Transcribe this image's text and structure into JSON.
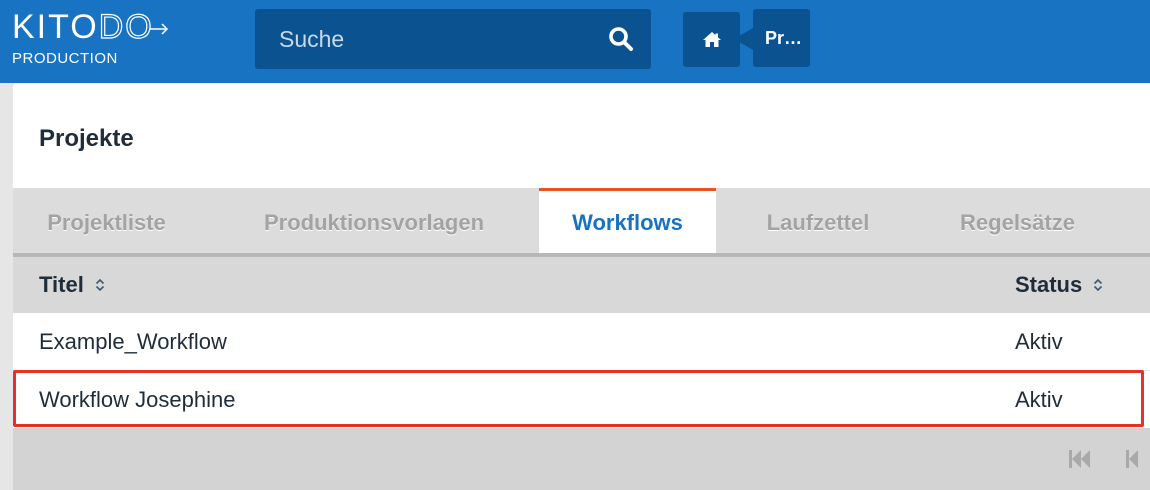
{
  "app": {
    "logo_main_a": "KITO",
    "logo_main_b": "DO",
    "logo_sub": "PRODUCTION"
  },
  "search": {
    "placeholder": "Suche",
    "icon": "search-icon"
  },
  "breadcrumb": {
    "home_icon": "home-icon",
    "current_label": "Pr…"
  },
  "page": {
    "title": "Projekte"
  },
  "tabs": [
    {
      "label": "Projektliste",
      "active": false
    },
    {
      "label": "Produktionsvorlagen",
      "active": false
    },
    {
      "label": "Workflows",
      "active": true
    },
    {
      "label": "Laufzettel",
      "active": false
    },
    {
      "label": "Regelsätze",
      "active": false
    }
  ],
  "table": {
    "columns": [
      {
        "label": "Titel",
        "sortable": true
      },
      {
        "label": "Status",
        "sortable": true
      }
    ],
    "rows": [
      {
        "title": "Example_Workflow",
        "status": "Aktiv"
      },
      {
        "title": "Workflow Josephine",
        "status": "Aktiv",
        "highlighted": true
      }
    ],
    "pager": {
      "icons": [
        "first-page-icon",
        "previous-page-icon"
      ]
    }
  },
  "colors": {
    "header_blue": "#1873c2",
    "header_dark_blue": "#0b5290",
    "active_tab_text": "#1873c2",
    "active_tab_accent": "#e8541c",
    "highlight_border": "#e53226"
  }
}
